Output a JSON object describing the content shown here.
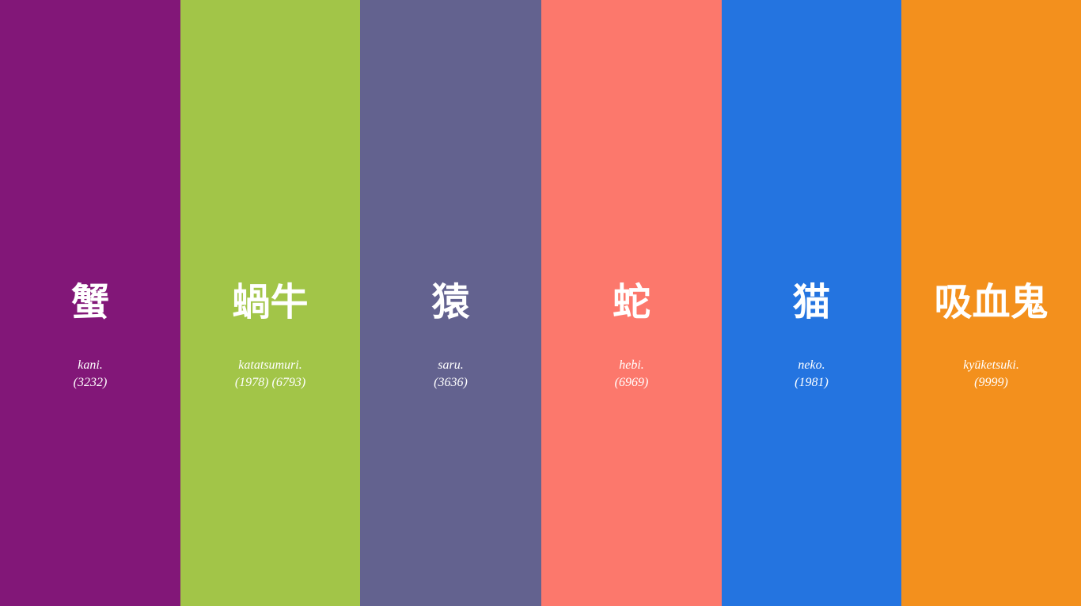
{
  "columns": [
    {
      "kanji": "蟹",
      "romaji": "kani.",
      "numbers": "(3232)",
      "color": "#821778",
      "icon": "crab"
    },
    {
      "kanji": "蝸牛",
      "romaji": "katatsumuri.",
      "numbers": "(1978) (6793)",
      "color": "#a2c548",
      "icon": "snail"
    },
    {
      "kanji": "猿",
      "romaji": "saru.",
      "numbers": "(3636)",
      "color": "#63628f",
      "icon": "monkey"
    },
    {
      "kanji": "蛇",
      "romaji": "hebi.",
      "numbers": "(6969)",
      "color": "#fc786c",
      "icon": "snake"
    },
    {
      "kanji": "猫",
      "romaji": "neko.",
      "numbers": "(1981)",
      "color": "#2474e0",
      "icon": "cat"
    },
    {
      "kanji": "吸血鬼",
      "romaji": "kyūketsuki.",
      "numbers": "(9999)",
      "color": "#f3901d",
      "icon": "vampire"
    }
  ]
}
